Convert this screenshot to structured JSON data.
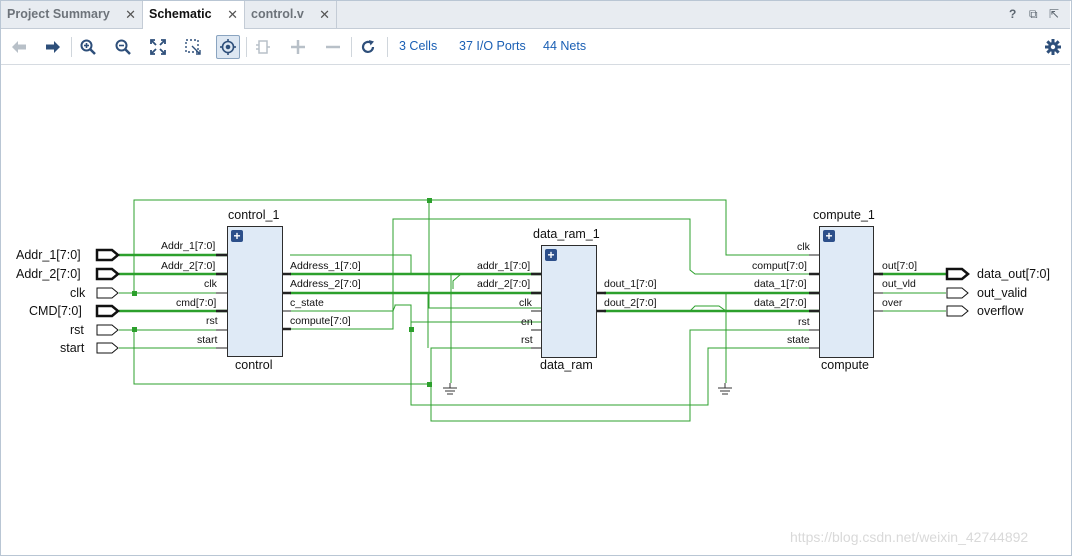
{
  "tabs": [
    {
      "label": "Project Summary",
      "active": false
    },
    {
      "label": "Schematic",
      "active": true
    },
    {
      "label": "control.v",
      "active": false
    }
  ],
  "window_controls": {
    "help": "?",
    "restore": "⧉",
    "expand": "⇱"
  },
  "toolbar": {
    "buttons": [
      "back-icon",
      "forward-icon",
      "zoom-in-icon",
      "zoom-out-icon",
      "fit-icon",
      "zoom-area-icon",
      "autofit-icon",
      "collapse-icon",
      "add-icon",
      "remove-icon",
      "refresh-icon",
      "settings-icon"
    ],
    "cells_link": "3 Cells",
    "io_ports_link": "37 I/O Ports",
    "nets_link": "44 Nets"
  },
  "schematic": {
    "input_ports": [
      "Addr_1[7:0]",
      "Addr_2[7:0]",
      "clk",
      "CMD[7:0]",
      "rst",
      "start"
    ],
    "output_ports": [
      "data_out[7:0]",
      "out_valid",
      "overflow"
    ],
    "cells": [
      {
        "instance": "control_1",
        "module": "control",
        "inputs": [
          "Addr_1[7:0]",
          "Addr_2[7:0]",
          "clk",
          "cmd[7:0]",
          "rst",
          "start"
        ],
        "outputs": [
          "Address_1[7:0]",
          "Address_2[7:0]",
          "c_state",
          "compute[7:0]"
        ]
      },
      {
        "instance": "data_ram_1",
        "module": "data_ram",
        "inputs": [
          "addr_1[7:0]",
          "addr_2[7:0]",
          "clk",
          "en",
          "rst"
        ],
        "outputs": [
          "dout_1[7:0]",
          "dout_2[7:0]"
        ]
      },
      {
        "instance": "compute_1",
        "module": "compute",
        "inputs": [
          "clk",
          "comput[7:0]",
          "data_1[7:0]",
          "data_2[7:0]",
          "rst",
          "state"
        ],
        "outputs": [
          "out[7:0]",
          "out_vld",
          "over"
        ]
      }
    ],
    "colors": {
      "net": "#2ca02c",
      "bus": "#1f8f1f",
      "cell_fill": "#dfeaf6",
      "link": "#1a5fb4"
    }
  },
  "watermark": "https://blog.csdn.net/weixin_42744892"
}
